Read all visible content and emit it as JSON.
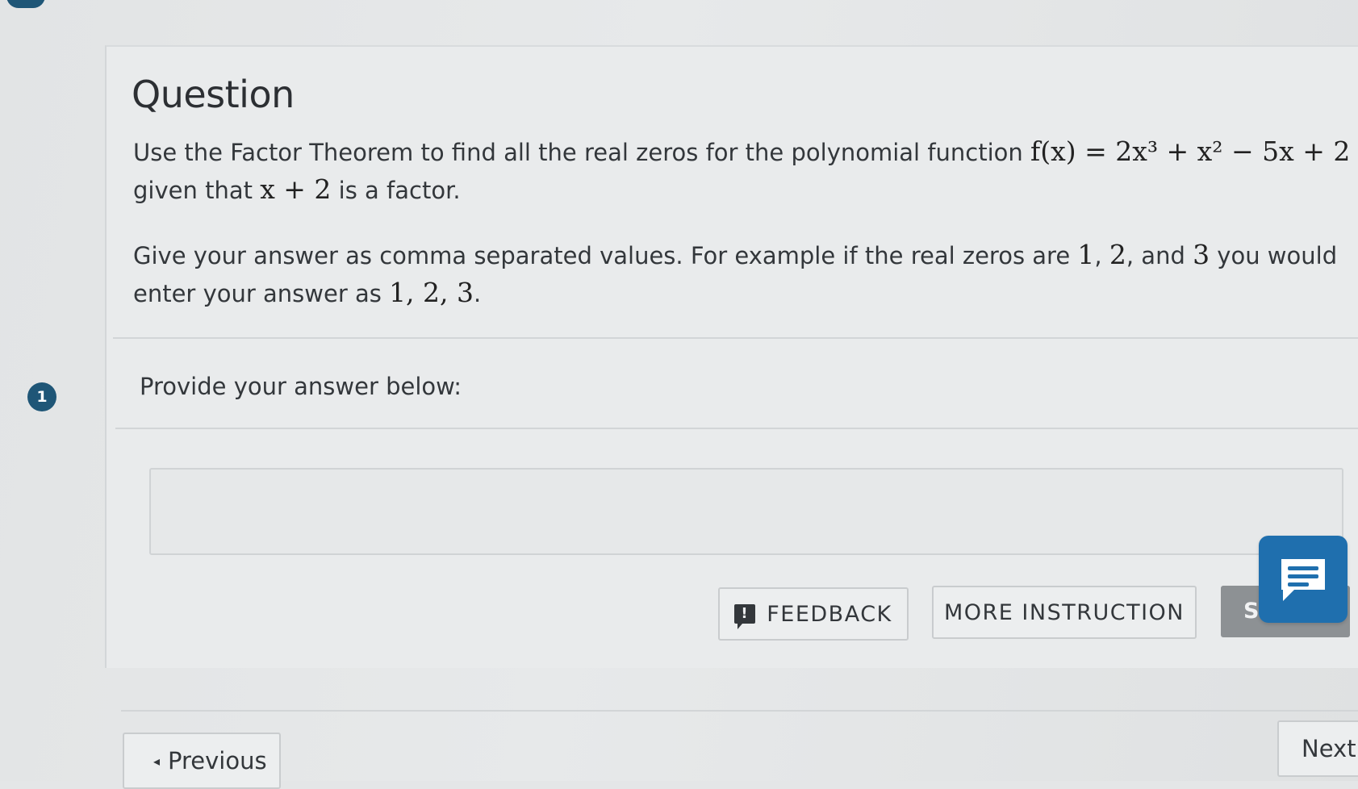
{
  "header": {
    "title": "Question"
  },
  "question": {
    "p1_lead": "Use the Factor Theorem to find all the real zeros for the polynomial function",
    "function_expr": "f(x) = 2x³ + x² − 5x + 2",
    "p1_mid": "given that",
    "factor_expr": "x + 2",
    "p1_tail": "is a factor.",
    "p2_lead": "Give your answer as comma separated values.  For example if the real zeros are",
    "example_a": "1",
    "example_b": "2",
    "p2_and": "and",
    "example_c": "3",
    "p2_mid": "you would enter your answer as",
    "example_format": "1, 2, 3",
    "period": "."
  },
  "step": {
    "number": "1",
    "prompt": "Provide your answer below:"
  },
  "answer": {
    "value": "",
    "placeholder": ""
  },
  "actions": {
    "feedback_icon": "!",
    "feedback_label": "FEEDBACK",
    "more_instruction_label": "MORE INSTRUCTION",
    "submit_label": "S"
  },
  "navigation": {
    "previous_label": "Previous",
    "next_label": "Next"
  },
  "icons": {
    "chat": "chat-bubble-icon",
    "feedback": "alert-icon",
    "previous": "caret-left-icon"
  },
  "colors": {
    "accent": "#1f5677",
    "chat": "#1f6fae",
    "submit": "#8d9194",
    "background": "#e4e6e7"
  }
}
